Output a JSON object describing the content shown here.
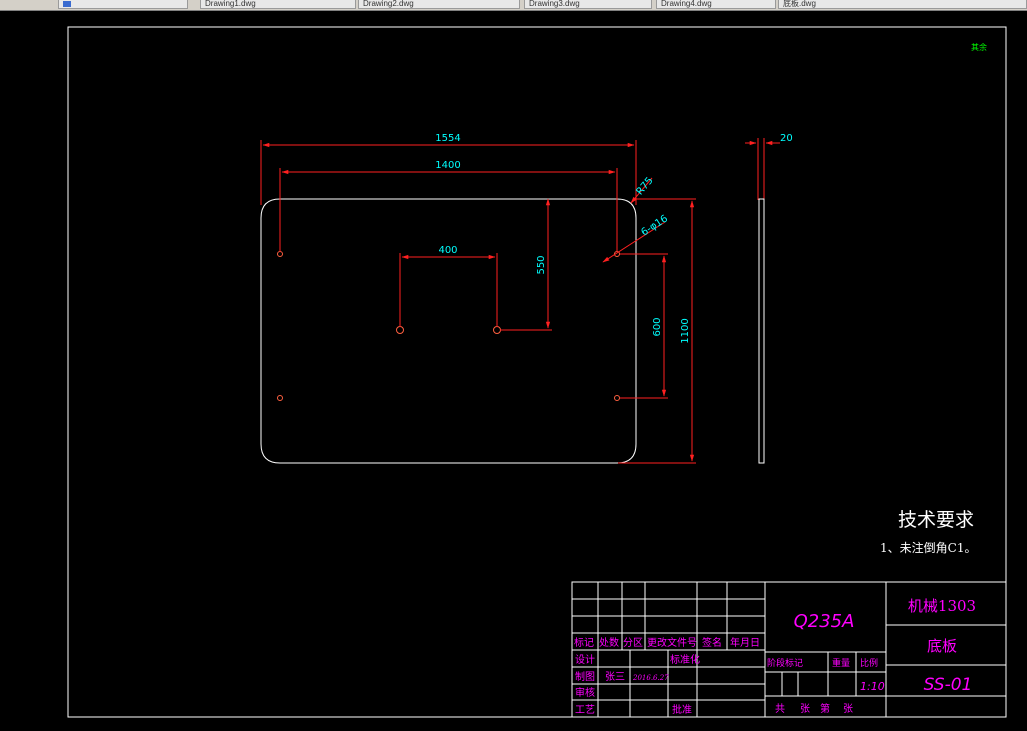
{
  "window": {
    "tabs": [
      {
        "label": ""
      },
      {
        "label": "Drawing1.dwg"
      },
      {
        "label": "Drawing2.dwg"
      },
      {
        "label": "Drawing3.dwg"
      },
      {
        "label": "Drawing4.dwg"
      },
      {
        "label": "底板.dwg"
      }
    ]
  },
  "drawing": {
    "corner_mark": "其余",
    "dimensions": {
      "overall_width": "1554",
      "hole_span_x": "1400",
      "center_spacing": "400",
      "center_offset_y": "550",
      "corner_radius": "R75",
      "holes": "6-φ16",
      "hole_span_y": "600",
      "overall_height": "1100",
      "thickness": "20"
    },
    "tech_requirements": {
      "title": "技术要求",
      "item1": "1、未注倒角C1。"
    },
    "title_block": {
      "material": "Q235A",
      "class_name": "机械1303",
      "part_name": "底板",
      "drawing_no": "SS-01",
      "scale": "1:10",
      "hdr_mark": "标记",
      "hdr_count": "处数",
      "hdr_zone": "分区",
      "hdr_change_doc": "更改文件号",
      "hdr_sign": "签名",
      "hdr_date": "年月日",
      "designer_label": "设计",
      "standardize_label": "标准化",
      "drafter_label": "制图",
      "drafter_name": "张三",
      "drafter_date": "2016.6.27",
      "review_label": "审核",
      "process_label": "工艺",
      "approve_label": "批准",
      "stage_label": "阶段标记",
      "weight_label": "重量",
      "ratio_label": "比例",
      "total_label": "共",
      "sheet_label": "张",
      "no_label": "第",
      "sheet2_label": "张"
    }
  },
  "colors": {
    "dimension": "#ff2020",
    "dim_text": "#00ffff",
    "outline": "#ffffff",
    "title_text": "#ff00ff",
    "corner_mark": "#00ff00"
  }
}
